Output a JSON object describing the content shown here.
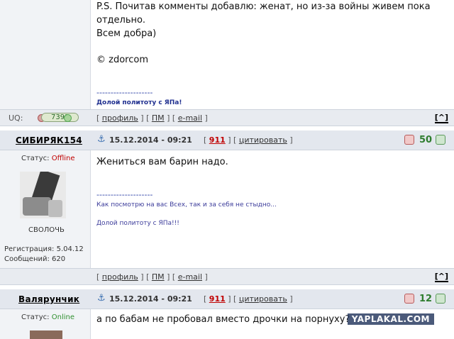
{
  "post1": {
    "lines": [
      "P.S. Почитав комменты добавлю: женат, но из-за войны живем пока",
      "отдельно.",
      "Всем добра)"
    ],
    "copyright": "© zdorcom",
    "sig_dash": "--------------------",
    "sig_line": "Долой политоту с ЯПа!",
    "uq_label": "UQ:",
    "uq_value": "7393"
  },
  "footer_links": {
    "profile": "профиль",
    "pm": "ПМ",
    "email": "e-mail",
    "top": "[^]"
  },
  "post2": {
    "username": "СИБИРЯК154",
    "date": "15.12.2014 - 09:21",
    "num": "911",
    "cite": "цитировать",
    "score": "50",
    "status_label": "Статус:",
    "status_value": "Offline",
    "rank": "СВОЛОЧЬ",
    "reg": "Регистрация: 5.04.12",
    "msgs": "Сообщений: 620",
    "text": "Жениться вам барин надо.",
    "sig_dash": "--------------------",
    "sig_line1": "Как посмотрю на вас Всех, так и за себя не стыдно...",
    "sig_line2": "Долой политоту с ЯПа!!!"
  },
  "post3": {
    "username": "Валярунчик",
    "date": "15.12.2014 - 09:21",
    "num": "911",
    "cite": "цитировать",
    "score": "12",
    "status_label": "Статус:",
    "status_value": "Online",
    "text": "а по бабам не пробовал вместо дрочки на порнуху?"
  },
  "watermark": "YAPLAKAL.COM",
  "colors": {
    "offline": "#c00000",
    "online": "#2f8f2f",
    "score": "#2f7d2f"
  }
}
